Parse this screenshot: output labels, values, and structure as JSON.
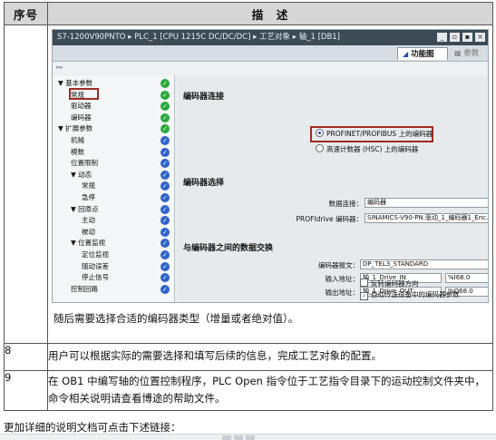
{
  "table": {
    "header": {
      "col_no": "序号",
      "col_desc": "描　述"
    },
    "row7": {
      "caption": "随后需要选择合适的编码器类型（增量或者绝对值）。"
    },
    "row8": {
      "no": "8",
      "text": "用户可以根据实际的需要选择和填写后续的信息，完成工艺对象的配置。"
    },
    "row9": {
      "no": "9",
      "text": "在 OB1 中编写轴的位置控制程序，PLC Open 指令位于工艺指令目录下的运动控制文件夹中，命令相关说明请查看博途的帮助文件。"
    }
  },
  "screenshot": {
    "breadcrumb": "S7-1200V90PNTO ▸ PLC_1 [CPU 1215C DC/DC/DC] ▸ 工艺对象 ▸ 轴_1 [DB1]",
    "win_buttons": [
      "_",
      "▫",
      "▪",
      "×"
    ],
    "tab_function": "功能图",
    "tab_params": "参数",
    "tree": [
      {
        "label": "▼ 基本参数",
        "indent": 0,
        "status": "green"
      },
      {
        "label": "常规",
        "indent": 1,
        "status": "green"
      },
      {
        "label": "驱动器",
        "indent": 1,
        "status": "green"
      },
      {
        "label": "编码器",
        "indent": 1,
        "status": "green"
      },
      {
        "label": "▼ 扩展参数",
        "indent": 0,
        "status": "green"
      },
      {
        "label": "机械",
        "indent": 1,
        "status": "blue"
      },
      {
        "label": "模数",
        "indent": 1,
        "status": "blue"
      },
      {
        "label": "位置限制",
        "indent": 1,
        "status": "blue"
      },
      {
        "label": "▼ 动态",
        "indent": 1,
        "status": "blue"
      },
      {
        "label": "常规",
        "indent": 2,
        "status": "blue"
      },
      {
        "label": "急停",
        "indent": 2,
        "status": "blue"
      },
      {
        "label": "▼ 回原点",
        "indent": 1,
        "status": "blue"
      },
      {
        "label": "主动",
        "indent": 2,
        "status": "blue"
      },
      {
        "label": "被动",
        "indent": 2,
        "status": "blue"
      },
      {
        "label": "▼ 位置监视",
        "indent": 1,
        "status": "blue"
      },
      {
        "label": "定位监视",
        "indent": 2,
        "status": "blue"
      },
      {
        "label": "随动误差",
        "indent": 2,
        "status": "blue"
      },
      {
        "label": "停止信号",
        "indent": 2,
        "status": "blue"
      },
      {
        "label": "控制回路",
        "indent": 1,
        "status": "blue"
      }
    ],
    "sec_conn": "编码器连接",
    "opt_profinet": "PROFINET/PROFIBUS 上的编码器",
    "opt_hsc": "高速计数器 (HSC) 上的编码器",
    "sec_select": "编码器选择",
    "lbl_data_conn": "数据连接：",
    "val_data_conn": "编码器",
    "lbl_profidrive": "PROFIdrive 编码器：",
    "val_profidrive": "SINAMICS-V90-PN.驱动_1_编码器1_Enc...",
    "sec_exchange": "与编码器之间的数据交换",
    "lbl_telegram": "编码器报文：",
    "val_telegram": "DP_TEL3_STANDARD",
    "lbl_input": "输入地址：",
    "val_input": "轴_1_Drive_IN",
    "val_input_addr": "%I68.0",
    "lbl_output": "输出地址：",
    "val_output": "轴_1_Drive_OUT",
    "val_output_addr": "%Q68.0",
    "chk_invert": "反转编码器方向",
    "chk_auto": "自动传送设备中的编码器参数",
    "chk_auto_mark": "✓",
    "dd_arrow": "▾",
    "check_glyph": "✓"
  },
  "after_table": "更加详细的说明文档可点击下述链接："
}
